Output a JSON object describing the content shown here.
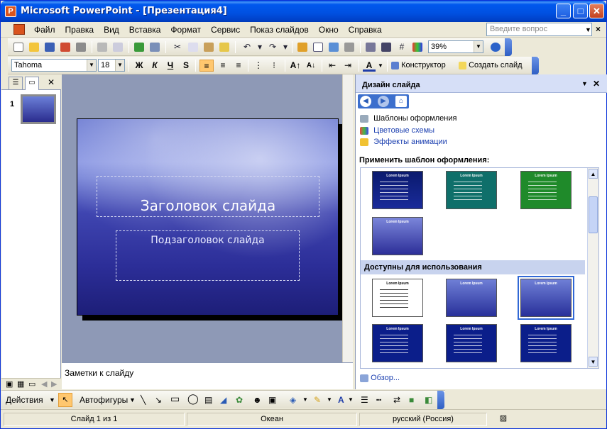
{
  "window": {
    "title": "Microsoft PowerPoint - [Презентация4]",
    "app_icon": "P",
    "minimize_glyph": "_",
    "maximize_glyph": "□",
    "close_glyph": "✕"
  },
  "menu": {
    "items": [
      "Файл",
      "Правка",
      "Вид",
      "Вставка",
      "Формат",
      "Сервис",
      "Показ слайдов",
      "Окно",
      "Справка"
    ],
    "help_placeholder": "Введите вопрос",
    "close_glyph": "×"
  },
  "standard_toolbar": {
    "zoom": "39%"
  },
  "format_toolbar": {
    "font": "Tahoma",
    "size": "18",
    "bold": "Ж",
    "italic": "К",
    "underline": "Ч",
    "shadow": "S",
    "designer_label": "Конструктор",
    "new_slide_label": "Создать слайд"
  },
  "slide": {
    "number": "1",
    "title_placeholder": "Заголовок слайда",
    "subtitle_placeholder": "Подзаголовок слайда"
  },
  "notes": {
    "placeholder": "Заметки к слайду"
  },
  "task_pane": {
    "title": "Дизайн слайда",
    "links": [
      {
        "label": "Шаблоны оформления",
        "icon": "design-templates-icon"
      },
      {
        "label": "Цветовые схемы",
        "icon": "color-schemes-icon"
      },
      {
        "label": "Эффекты анимации",
        "icon": "animation-effects-icon"
      }
    ],
    "apply_label": "Применить шаблон оформления:",
    "available_label": "Доступны для использования",
    "browse_label": "Обзор...",
    "thumb_title": "Lorem Ipsum"
  },
  "draw_toolbar": {
    "actions_label": "Действия",
    "autoshapes_label": "Автофигуры"
  },
  "status": {
    "slide_count": "Слайд 1 из 1",
    "design": "Океан",
    "language": "русский (Россия)"
  },
  "colors": {
    "title_bar": "#0058ee",
    "task_pane_header": "#d6dff7",
    "slide_bg": "#2c2e98",
    "workspace": "#8e99b6"
  }
}
